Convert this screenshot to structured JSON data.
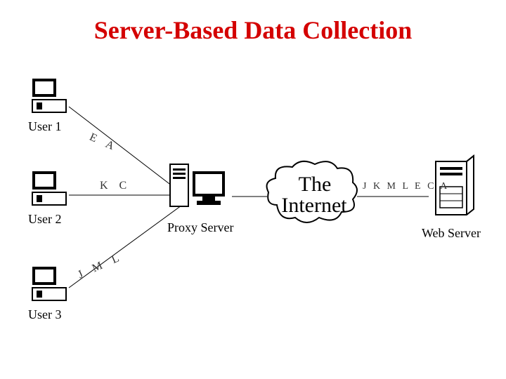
{
  "title": "Server-Based Data Collection",
  "nodes": {
    "user1": "User 1",
    "user2": "User 2",
    "user3": "User 3",
    "proxy": "Proxy Server",
    "internet_line1": "The",
    "internet_line2": "Internet",
    "web": "Web Server"
  },
  "edges": {
    "u1_proxy": "E A",
    "u2_proxy": "K  C",
    "u3_proxy": "J  M  L",
    "proxy_internet": "",
    "internet_web": "J K M L E C A"
  }
}
